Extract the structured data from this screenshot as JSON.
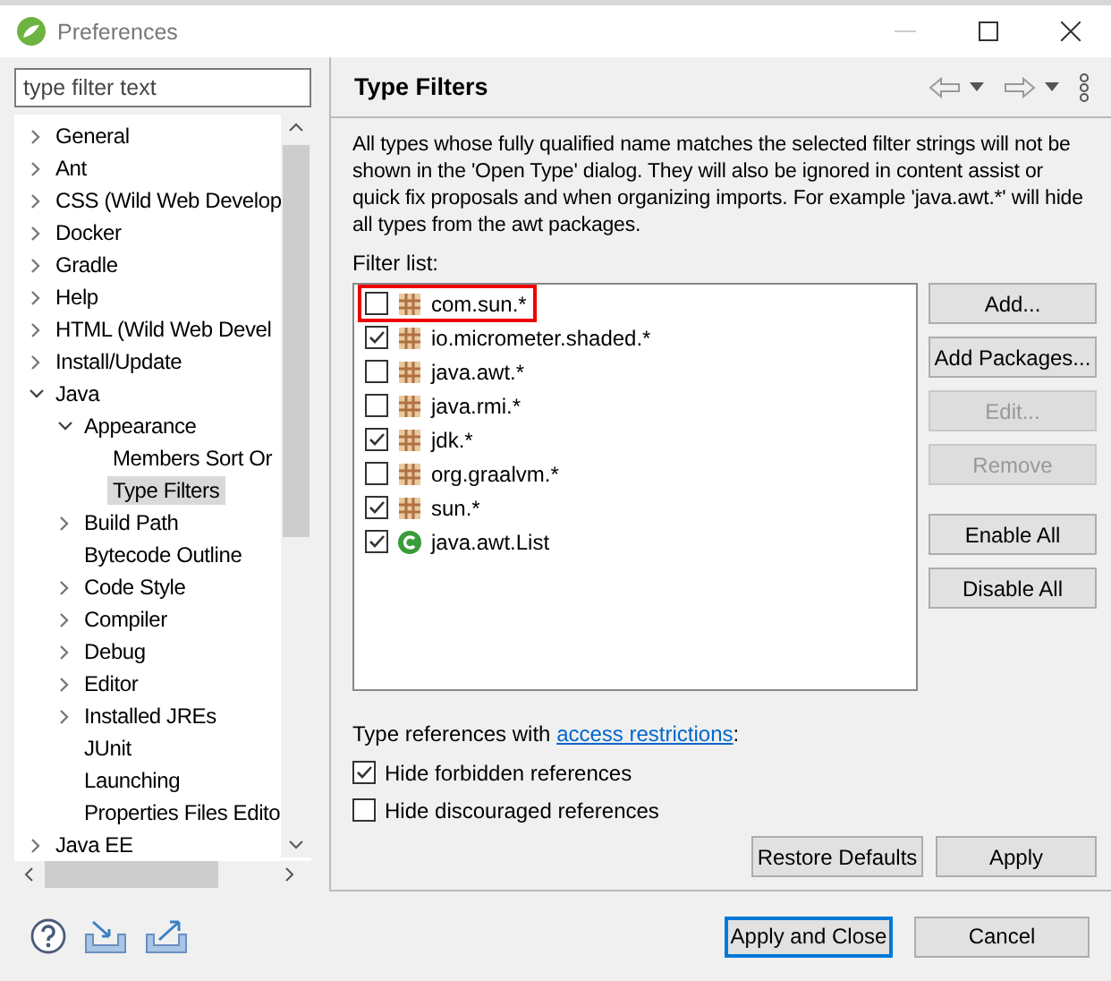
{
  "window": {
    "title": "Preferences"
  },
  "sidebar": {
    "filter": {
      "placeholder": "type filter text"
    },
    "items": [
      {
        "label": "General",
        "expanded": false,
        "selected": false
      },
      {
        "label": "Ant",
        "expanded": false,
        "selected": false
      },
      {
        "label": "CSS (Wild Web Develop",
        "expanded": false,
        "selected": false
      },
      {
        "label": "Docker",
        "expanded": false,
        "selected": false
      },
      {
        "label": "Gradle",
        "expanded": false,
        "selected": false
      },
      {
        "label": "Help",
        "expanded": false,
        "selected": false
      },
      {
        "label": "HTML (Wild Web Devel",
        "expanded": false,
        "selected": false
      },
      {
        "label": "Install/Update",
        "expanded": false,
        "selected": false
      },
      {
        "label": "Java",
        "expanded": true,
        "selected": false,
        "children": [
          {
            "label": "Appearance",
            "expanded": true,
            "selected": false,
            "children": [
              {
                "label": "Members Sort Or",
                "selected": false
              },
              {
                "label": "Type Filters",
                "selected": true
              }
            ]
          },
          {
            "label": "Build Path",
            "expanded": false,
            "selected": false
          },
          {
            "label": "Bytecode Outline",
            "selected": false
          },
          {
            "label": "Code Style",
            "expanded": false,
            "selected": false
          },
          {
            "label": "Compiler",
            "expanded": false,
            "selected": false
          },
          {
            "label": "Debug",
            "expanded": false,
            "selected": false
          },
          {
            "label": "Editor",
            "expanded": false,
            "selected": false
          },
          {
            "label": "Installed JREs",
            "expanded": false,
            "selected": false
          },
          {
            "label": "JUnit",
            "selected": false
          },
          {
            "label": "Launching",
            "selected": false
          },
          {
            "label": "Properties Files Edito",
            "selected": false
          }
        ]
      },
      {
        "label": "Java EE",
        "expanded": false,
        "selected": false
      }
    ]
  },
  "page": {
    "title": "Type Filters",
    "description": "All types whose fully qualified name matches the selected filter strings will not be shown in the 'Open Type' dialog. They will also be ignored in content assist or quick fix proposals and when organizing imports. For example 'java.awt.*' will hide all types from the awt packages.",
    "filter_label": "Filter list:",
    "filters": [
      {
        "label": "com.sun.*",
        "kind": "package",
        "checked": false,
        "outlined": true
      },
      {
        "label": "io.micrometer.shaded.*",
        "kind": "package",
        "checked": true,
        "outlined": false
      },
      {
        "label": "java.awt.*",
        "kind": "package",
        "checked": false,
        "outlined": false
      },
      {
        "label": "java.rmi.*",
        "kind": "package",
        "checked": false,
        "outlined": false
      },
      {
        "label": "jdk.*",
        "kind": "package",
        "checked": true,
        "outlined": false
      },
      {
        "label": "org.graalvm.*",
        "kind": "package",
        "checked": false,
        "outlined": false
      },
      {
        "label": "sun.*",
        "kind": "package",
        "checked": true,
        "outlined": false
      },
      {
        "label": "java.awt.List",
        "kind": "class",
        "checked": true,
        "outlined": false
      }
    ],
    "list_buttons": [
      {
        "label": "Add...",
        "disabled": false
      },
      {
        "label": "Add Packages...",
        "disabled": false
      },
      {
        "label": "Edit...",
        "disabled": true
      },
      {
        "label": "Remove",
        "disabled": true
      }
    ],
    "toggle_buttons": [
      {
        "label": "Enable All",
        "disabled": false
      },
      {
        "label": "Disable All",
        "disabled": false
      }
    ],
    "restrictions_text": "Type references with ",
    "restrictions_link": "access restrictions",
    "restrictions_colon": ":",
    "options": [
      {
        "label": "Hide forbidden references",
        "checked": true
      },
      {
        "label": "Hide discouraged references",
        "checked": false
      }
    ],
    "restore_button": "Restore Defaults",
    "apply_button": "Apply"
  },
  "footer": {
    "buttons": [
      {
        "label": "Apply and Close",
        "default": true
      },
      {
        "label": "Cancel",
        "default": false
      }
    ]
  }
}
